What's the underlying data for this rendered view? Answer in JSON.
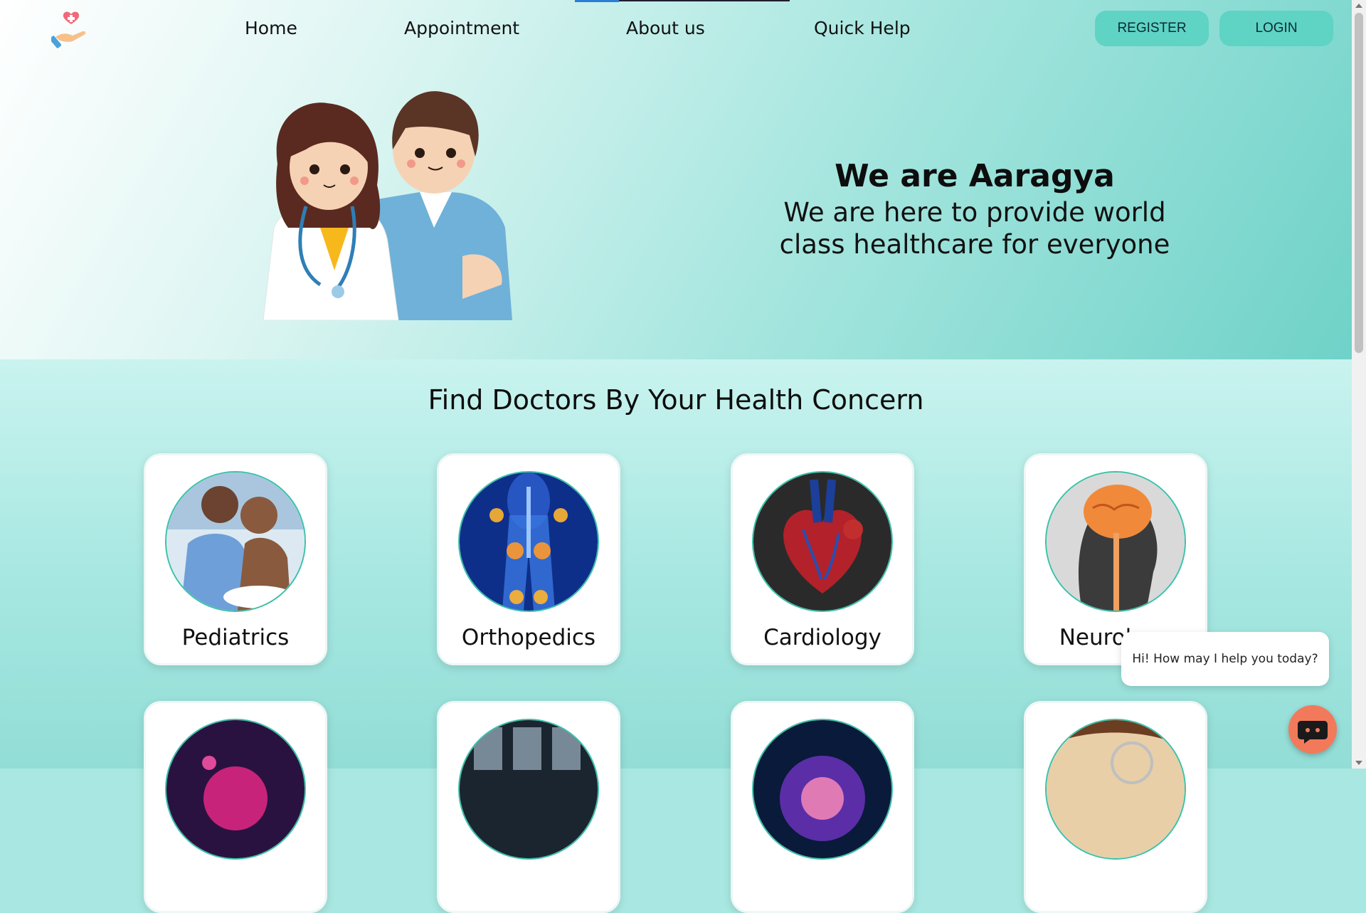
{
  "nav": {
    "links": [
      {
        "label": "Home"
      },
      {
        "label": "Appointment"
      },
      {
        "label": "About us"
      },
      {
        "label": "Quick Help"
      }
    ],
    "register": "REGISTER",
    "login": "LOGIN"
  },
  "hero": {
    "title": "We are Aaragya",
    "subtitle_line1": "We are here to provide world",
    "subtitle_line2": "class healthcare for everyone"
  },
  "section": {
    "title": "Find Doctors By Your Health Concern",
    "cards": [
      {
        "label": "Pediatrics"
      },
      {
        "label": "Orthopedics"
      },
      {
        "label": "Cardiology"
      },
      {
        "label": "Neurology"
      }
    ]
  },
  "chat": {
    "greeting": "Hi! How may I help you today?"
  }
}
